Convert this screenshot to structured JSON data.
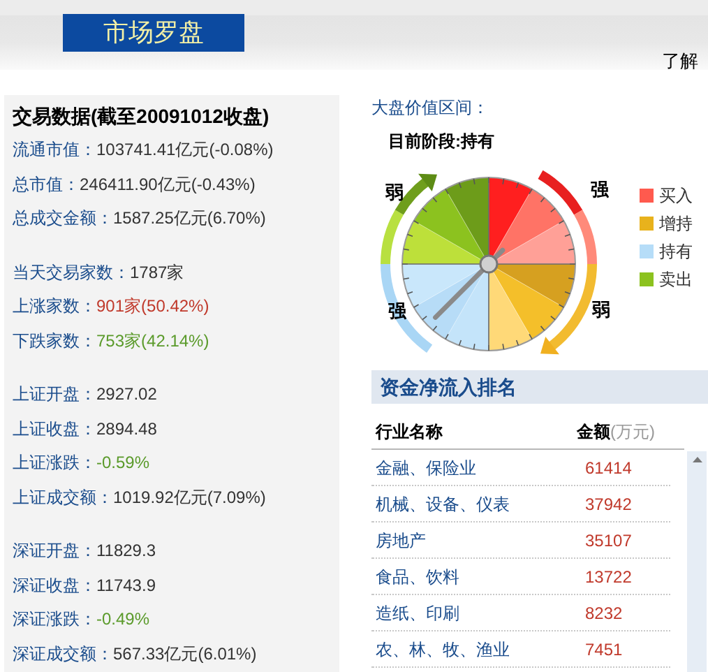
{
  "header": {
    "title": "市场罗盘",
    "link": "了解"
  },
  "trade_data": {
    "title": "交易数据(截至20091012收盘)",
    "groups": [
      [
        {
          "label": "流通市值：",
          "value": "103741.41亿元(-0.08%)",
          "color": "#333333"
        },
        {
          "label": "总市值：",
          "value": "246411.90亿元(-0.43%)",
          "color": "#333333"
        },
        {
          "label": "总成交金额：",
          "value": "1587.25亿元(6.70%)",
          "color": "#333333"
        }
      ],
      [
        {
          "label": "当天交易家数：",
          "value": "1787家",
          "color": "#333333"
        },
        {
          "label": "上涨家数：",
          "value": "901家(50.42%)",
          "color": "#c0392b"
        },
        {
          "label": "下跌家数：",
          "value": "753家(42.14%)",
          "color": "#5a9a2a"
        }
      ],
      [
        {
          "label": "上证开盘：",
          "value": "2927.02",
          "color": "#333333"
        },
        {
          "label": "上证收盘：",
          "value": "2894.48",
          "color": "#333333"
        },
        {
          "label": "上证涨跌：",
          "value": "-0.59%",
          "color": "#5a9a2a"
        },
        {
          "label": "上证成交额：",
          "value": "1019.92亿元(7.09%)",
          "color": "#333333"
        }
      ],
      [
        {
          "label": "深证开盘：",
          "value": "11829.3",
          "color": "#333333"
        },
        {
          "label": "深证收盘：",
          "value": "11743.9",
          "color": "#333333"
        },
        {
          "label": "深证涨跌：",
          "value": "-0.49%",
          "color": "#5a9a2a"
        },
        {
          "label": "深证成交额：",
          "value": "567.33亿元(6.01%)",
          "color": "#333333"
        }
      ]
    ]
  },
  "compass": {
    "title": "大盘价值区间：",
    "stage": "目前阶段:持有",
    "arrow_labels": {
      "left_top": "弱",
      "left_bottom": "强",
      "right_top": "强",
      "right_bottom": "弱"
    },
    "legend": [
      {
        "label": "买入",
        "color": "#ff5a4e"
      },
      {
        "label": "增持",
        "color": "#e8b21c"
      },
      {
        "label": "持有",
        "color": "#b6ddf8"
      },
      {
        "label": "卖出",
        "color": "#8cc21f"
      }
    ]
  },
  "inflow_ranking": {
    "title": "资金净流入排名",
    "columns": [
      "行业名称",
      "金额"
    ],
    "unit": "(万元)",
    "rows": [
      {
        "name": "金融、保险业",
        "amount": "61414"
      },
      {
        "name": "机械、设备、仪表",
        "amount": "37942"
      },
      {
        "name": "房地产",
        "amount": "35107"
      },
      {
        "name": "食品、饮料",
        "amount": "13722"
      },
      {
        "name": "造纸、印刷",
        "amount": "8232"
      },
      {
        "name": "农、林、牧、渔业",
        "amount": "7451"
      }
    ]
  }
}
